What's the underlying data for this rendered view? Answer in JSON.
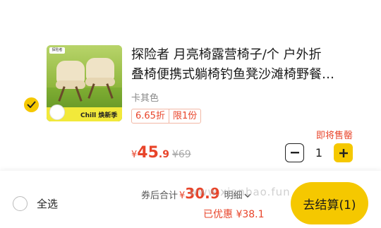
{
  "product": {
    "title_line1": "探险者 月亮椅露营椅子/个 户外折",
    "title_line2": "叠椅便携式躺椅钓鱼凳沙滩椅野餐…",
    "sku": "卡其色",
    "tags": [
      "6.65折",
      "限1份"
    ],
    "status": "即将售罄",
    "price_currency": "¥",
    "price_int": "45",
    "price_dec": ".9",
    "original_price": "¥69",
    "quantity": "1",
    "selected": true,
    "thumbnail": {
      "brand_tag": "探险者",
      "band_text": "Chill 焕新季"
    }
  },
  "bottom_bar": {
    "select_all_label": "全选",
    "total_label": "券后合计",
    "total_currency": "¥",
    "total_amount": "30.9",
    "detail_label": "明细",
    "discount_text": "已优惠 ¥38.1",
    "checkout_label": "去结算(1)"
  },
  "watermark": "www.xianbao.fun",
  "colors": {
    "accent": "#f5c800",
    "price": "#e8442a"
  }
}
